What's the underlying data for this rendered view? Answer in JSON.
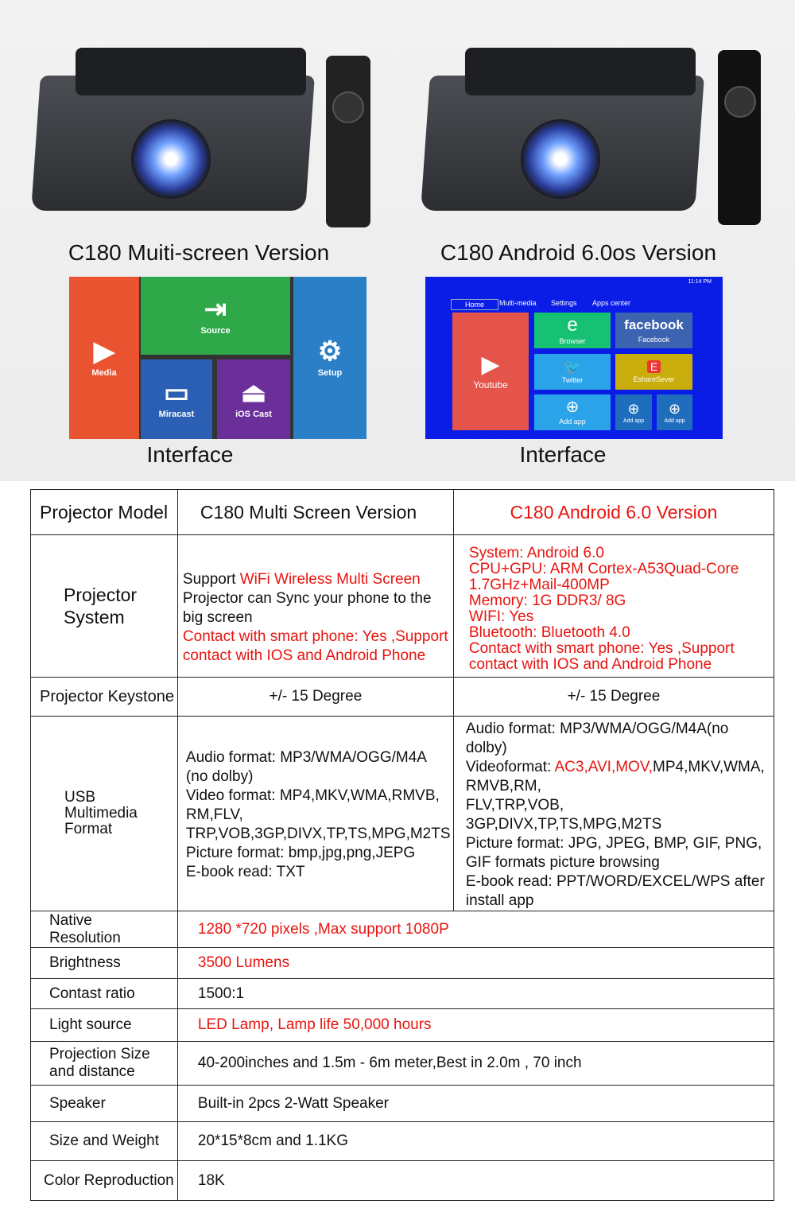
{
  "products": [
    {
      "caption": "C180 Muiti-screen Version",
      "interface_caption": "Interface"
    },
    {
      "caption": "C180 Android 6.0os Version",
      "interface_caption": "Interface"
    }
  ],
  "multiscreen_ui": {
    "media": "Media",
    "source": "Source",
    "setup": "Setup",
    "miracast": "Miracast",
    "ios_cast": "iOS Cast"
  },
  "android_ui": {
    "time": "11:14 PM",
    "tabs": [
      "Home",
      "Multi-media",
      "Settings",
      "Apps center"
    ],
    "youtube": "Youtube",
    "browser": "Browser",
    "facebook_logo": "facebook",
    "facebook": "Facebook",
    "twitter": "Twitter",
    "eshare": "EshareSever",
    "add_app": "Add app"
  },
  "colors": {
    "accent_red": "#e8140f",
    "android_bg": "#0a1de6"
  },
  "table": {
    "header": [
      "Projector Model",
      "C180 Multi Screen Version",
      "C180 Android 6.0 Version"
    ],
    "system_label": "Projector System",
    "system_multi": [
      [
        {
          "t": "Support "
        },
        {
          "t": "WiFi Wireless Multi Screen",
          "r": 1
        }
      ],
      [
        {
          "t": "Projector can Sync your phone to the"
        }
      ],
      [
        {
          "t": "big screen"
        }
      ],
      [
        {
          "t": "Contact with smart phone: Yes ,Support",
          "r": 1
        }
      ],
      [
        {
          "t": "contact with IOS and Android Phone",
          "r": 1
        }
      ]
    ],
    "system_android": [
      [
        {
          "t": "System: Android 6.0",
          "r": 1
        }
      ],
      [
        {
          "t": "CPU+GPU: ARM Cortex-A53Quad-Core",
          "r": 1
        }
      ],
      [
        {
          "t": "1.7GHz+Mail-400MP",
          "r": 1
        }
      ],
      [
        {
          "t": "Memory: 1G DDR3/ 8G",
          "r": 1
        }
      ],
      [
        {
          "t": "WIFI: Yes",
          "r": 1
        }
      ],
      [
        {
          "t": "Bluetooth: Bluetooth 4.0",
          "r": 1
        }
      ],
      [
        {
          "t": "Contact with smart phone: Yes ,Support",
          "r": 1
        }
      ],
      [
        {
          "t": "contact with IOS and Android Phone",
          "r": 1
        }
      ]
    ],
    "keystone_label": "Projector Keystone",
    "keystone_multi": "+/- 15 Degree",
    "keystone_android": "+/- 15 Degree",
    "usb_label": "USB Multimedia Format",
    "usb_multi": [
      [
        {
          "t": "Audio format: MP3/WMA/OGG/M4A"
        }
      ],
      [
        {
          "t": "(no dolby)"
        }
      ],
      [
        {
          "t": "Video format: MP4,MKV,WMA,RMVB,"
        }
      ],
      [
        {
          "t": "RM,FLV,"
        }
      ],
      [
        {
          "t": "TRP,VOB,3GP,DIVX,TP,TS,MPG,M2TS"
        }
      ],
      [
        {
          "t": "Picture format: bmp,jpg,png,JEPG"
        }
      ],
      [
        {
          "t": "E-book read: TXT"
        }
      ]
    ],
    "usb_android": [
      [
        {
          "t": "Audio format: MP3/WMA/OGG/M4A(no dolby)"
        }
      ],
      [
        {
          "t": "Videoformat: "
        },
        {
          "t": "AC3,AVI,MOV,",
          "r": 1
        },
        {
          "t": "MP4,MKV,WMA,"
        }
      ],
      [
        {
          "t": "RMVB,RM,"
        }
      ],
      [
        {
          "t": "FLV,TRP,VOB,"
        }
      ],
      [
        {
          "t": "3GP,DIVX,TP,TS,MPG,M2TS"
        }
      ],
      [
        {
          "t": "Picture format: JPG, JPEG, BMP, GIF, PNG,"
        }
      ],
      [
        {
          "t": "GIF formats picture browsing"
        }
      ],
      [
        {
          "t": "E-book read: PPT/WORD/EXCEL/WPS after"
        }
      ],
      [
        {
          "t": "install app"
        }
      ]
    ],
    "rows": [
      {
        "label": "Native Resolution",
        "value": "1280 *720 pixels ,Max support 1080P",
        "red": true
      },
      {
        "label": "Brightness",
        "value": "3500 Lumens",
        "red": true
      },
      {
        "label": "Contast ratio",
        "value": "1500:1",
        "red": false
      },
      {
        "label": "Light source",
        "value": "LED Lamp, Lamp life 50,000 hours",
        "red": true
      },
      {
        "label": "Projection Size and distance",
        "value": "40-200inches and 1.5m - 6m meter,Best in 2.0m , 70 inch",
        "red": false
      },
      {
        "label": "Speaker",
        "value": "Built-in 2pcs 2-Watt Speaker",
        "red": false
      },
      {
        "label": "Size and Weight",
        "value": "20*15*8cm and  1.1KG",
        "red": false
      },
      {
        "label": "Color Reproduction",
        "value": "18K",
        "red": false
      }
    ]
  }
}
